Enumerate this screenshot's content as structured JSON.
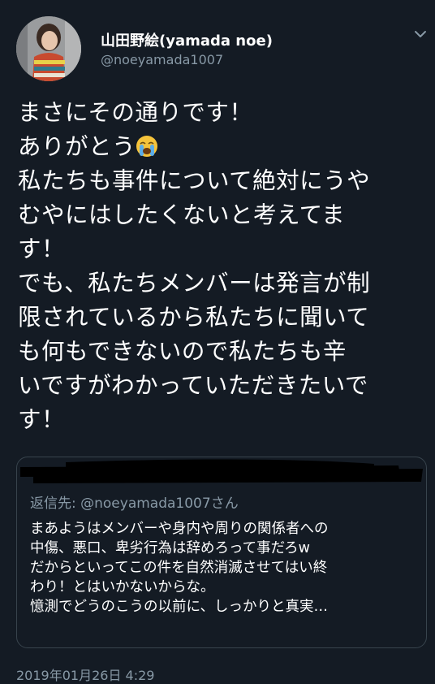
{
  "user": {
    "display_name": "山田野絵(yamada noe)",
    "handle": "@noeyamada1007",
    "avatar_icon": "profile-photo"
  },
  "tweet": {
    "lines": [
      "まさにその通りです！",
      "ありがとう",
      "私たちも事件について絶対にうや",
      "むやにはしたくないと考えてま",
      "す！",
      "でも、私たちメンバーは発言が制",
      "限されているから私たちに聞いて",
      "も何もできないので私たちも辛",
      "いですがわかっていただきたいで",
      "す！"
    ],
    "emoji_icon": "loudly-crying-face-icon"
  },
  "quoted": {
    "reply_to": "返信先: @noeyamada1007さん",
    "lines": [
      "まあようはメンバーや身内や周りの関係者への",
      "中傷、悪口、卑劣行為は辞めろって事だろw",
      "だからといってこの件を自然消滅させてはい終",
      "わり！とはいかないからな。",
      "憶測でどうのこうの以前に、しっかりと真実…"
    ]
  },
  "timestamp": "2019年01月26日 4:29",
  "colors": {
    "background": "#141b24",
    "text": "#ffffff",
    "secondary": "#8899a6",
    "border": "#38444d"
  }
}
